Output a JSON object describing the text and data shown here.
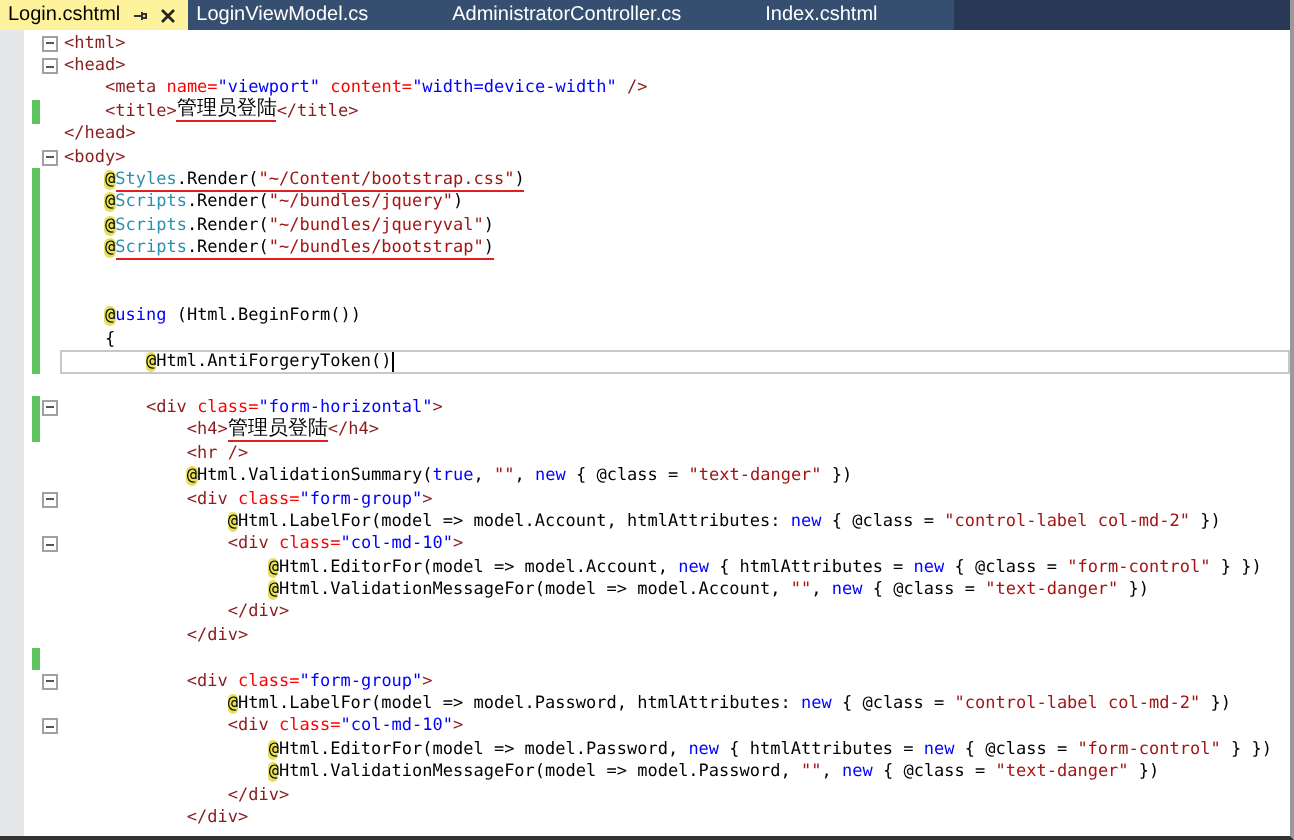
{
  "tabs": [
    {
      "label": "Login.cshtml",
      "selected": true,
      "pinned": true
    },
    {
      "label": "LoginViewModel.cs",
      "selected": false,
      "pinned": false
    },
    {
      "label": "AdministratorController.cs",
      "selected": false,
      "pinned": false
    },
    {
      "label": "Index.cshtml",
      "selected": false,
      "pinned": false
    }
  ],
  "lines": [
    {
      "changed": false,
      "foldable": true,
      "current": false,
      "tokens": [
        {
          "kind": "tag",
          "text": "<html>"
        }
      ]
    },
    {
      "changed": false,
      "foldable": true,
      "current": false,
      "tokens": [
        {
          "kind": "tag",
          "text": "<head>"
        }
      ]
    },
    {
      "changed": false,
      "foldable": false,
      "current": false,
      "tokens": [
        {
          "kind": "tag",
          "text": "    <meta"
        },
        {
          "kind": "attr",
          "text": " name="
        },
        {
          "kind": "value",
          "text": "\"viewport\""
        },
        {
          "kind": "attr",
          "text": " content="
        },
        {
          "kind": "value",
          "text": "\"width=device-width\""
        },
        {
          "kind": "tag",
          "text": " />"
        }
      ]
    },
    {
      "changed": true,
      "foldable": false,
      "current": false,
      "tokens": [
        {
          "kind": "tag",
          "text": "    <title>"
        },
        {
          "kind": "plain",
          "text": "管理员登陆",
          "underlined": true
        },
        {
          "kind": "tag",
          "text": "</title>"
        }
      ]
    },
    {
      "changed": false,
      "foldable": false,
      "current": false,
      "tokens": [
        {
          "kind": "tag",
          "text": "</head>"
        }
      ]
    },
    {
      "changed": false,
      "foldable": true,
      "current": false,
      "tokens": [
        {
          "kind": "tag",
          "text": "<body>"
        }
      ]
    },
    {
      "changed": true,
      "foldable": false,
      "current": false,
      "tokens": [
        {
          "kind": "razor",
          "text": "    @"
        },
        {
          "kind": "type",
          "text": "Styles",
          "underlined": true
        },
        {
          "kind": "plain",
          "text": ".Render(",
          "underlined": true
        },
        {
          "kind": "string",
          "text": "\"~/Content/bootstrap.css\"",
          "underlined": true
        },
        {
          "kind": "plain",
          "text": ")",
          "underlined": true
        }
      ]
    },
    {
      "changed": true,
      "foldable": false,
      "current": false,
      "tokens": [
        {
          "kind": "razor",
          "text": "    @"
        },
        {
          "kind": "type",
          "text": "Scripts"
        },
        {
          "kind": "plain",
          "text": ".Render("
        },
        {
          "kind": "string",
          "text": "\"~/bundles/jquery\""
        },
        {
          "kind": "plain",
          "text": ")"
        }
      ]
    },
    {
      "changed": true,
      "foldable": false,
      "current": false,
      "tokens": [
        {
          "kind": "razor",
          "text": "    @"
        },
        {
          "kind": "type",
          "text": "Scripts"
        },
        {
          "kind": "plain",
          "text": ".Render("
        },
        {
          "kind": "string",
          "text": "\"~/bundles/jqueryval\""
        },
        {
          "kind": "plain",
          "text": ")"
        }
      ]
    },
    {
      "changed": true,
      "foldable": false,
      "current": false,
      "tokens": [
        {
          "kind": "razor",
          "text": "    @"
        },
        {
          "kind": "type",
          "text": "Scripts",
          "underlined": true
        },
        {
          "kind": "plain",
          "text": ".Render(",
          "underlined": true
        },
        {
          "kind": "string",
          "text": "\"~/bundles/bootstrap\"",
          "underlined": true
        },
        {
          "kind": "plain",
          "text": ")",
          "underlined": true
        }
      ]
    },
    {
      "changed": true,
      "foldable": false,
      "current": false
    },
    {
      "changed": true,
      "foldable": false,
      "current": false
    },
    {
      "changed": true,
      "foldable": false,
      "current": false,
      "tokens": [
        {
          "kind": "razor",
          "text": "    @"
        },
        {
          "kind": "keyword",
          "text": "using"
        },
        {
          "kind": "plain",
          "text": " (Html.BeginForm())"
        }
      ]
    },
    {
      "changed": true,
      "foldable": false,
      "current": false,
      "tokens": [
        {
          "kind": "plain",
          "text": "    {"
        }
      ]
    },
    {
      "changed": true,
      "foldable": false,
      "current": true,
      "tokens": [
        {
          "kind": "razor",
          "text": "        @"
        },
        {
          "kind": "plain",
          "text": "Html.AntiForgeryToken()"
        }
      ]
    },
    {
      "changed": false,
      "foldable": false,
      "current": false
    },
    {
      "changed": true,
      "foldable": true,
      "current": false,
      "tokens": [
        {
          "kind": "tag",
          "text": "        <div"
        },
        {
          "kind": "attr",
          "text": " class="
        },
        {
          "kind": "value",
          "text": "\"form-horizontal\""
        },
        {
          "kind": "tag",
          "text": ">"
        }
      ]
    },
    {
      "changed": true,
      "foldable": false,
      "current": false,
      "tokens": [
        {
          "kind": "tag",
          "text": "            <h4>"
        },
        {
          "kind": "plain",
          "text": "管理员登陆",
          "underlined": true
        },
        {
          "kind": "tag",
          "text": "</h4>"
        }
      ]
    },
    {
      "changed": false,
      "foldable": false,
      "current": false,
      "tokens": [
        {
          "kind": "tag",
          "text": "            <hr />"
        }
      ]
    },
    {
      "changed": false,
      "foldable": false,
      "current": false,
      "tokens": [
        {
          "kind": "razor",
          "text": "            @"
        },
        {
          "kind": "plain",
          "text": "Html.ValidationSummary("
        },
        {
          "kind": "keyword",
          "text": "true"
        },
        {
          "kind": "plain",
          "text": ", "
        },
        {
          "kind": "string",
          "text": "\"\""
        },
        {
          "kind": "plain",
          "text": ", "
        },
        {
          "kind": "keyword",
          "text": "new"
        },
        {
          "kind": "plain",
          "text": " { @class = "
        },
        {
          "kind": "string",
          "text": "\"text-danger\""
        },
        {
          "kind": "plain",
          "text": " })"
        }
      ]
    },
    {
      "changed": false,
      "foldable": true,
      "current": false,
      "tokens": [
        {
          "kind": "tag",
          "text": "            <div"
        },
        {
          "kind": "attr",
          "text": " class="
        },
        {
          "kind": "value",
          "text": "\"form-group\""
        },
        {
          "kind": "tag",
          "text": ">"
        }
      ]
    },
    {
      "changed": false,
      "foldable": false,
      "current": false,
      "tokens": [
        {
          "kind": "razor",
          "text": "                @"
        },
        {
          "kind": "plain",
          "text": "Html.LabelFor(model => model.Account, htmlAttributes: "
        },
        {
          "kind": "keyword",
          "text": "new"
        },
        {
          "kind": "plain",
          "text": " { @class = "
        },
        {
          "kind": "string",
          "text": "\"control-label col-md-2\""
        },
        {
          "kind": "plain",
          "text": " })"
        }
      ]
    },
    {
      "changed": false,
      "foldable": true,
      "current": false,
      "tokens": [
        {
          "kind": "tag",
          "text": "                <div"
        },
        {
          "kind": "attr",
          "text": " class="
        },
        {
          "kind": "value",
          "text": "\"col-md-10\""
        },
        {
          "kind": "tag",
          "text": ">"
        }
      ]
    },
    {
      "changed": false,
      "foldable": false,
      "current": false,
      "tokens": [
        {
          "kind": "razor",
          "text": "                    @"
        },
        {
          "kind": "plain",
          "text": "Html.EditorFor(model => model.Account, "
        },
        {
          "kind": "keyword",
          "text": "new"
        },
        {
          "kind": "plain",
          "text": " { htmlAttributes = "
        },
        {
          "kind": "keyword",
          "text": "new"
        },
        {
          "kind": "plain",
          "text": " { @class = "
        },
        {
          "kind": "string",
          "text": "\"form-control\""
        },
        {
          "kind": "plain",
          "text": " } })"
        }
      ]
    },
    {
      "changed": false,
      "foldable": false,
      "current": false,
      "tokens": [
        {
          "kind": "razor",
          "text": "                    @"
        },
        {
          "kind": "plain",
          "text": "Html.ValidationMessageFor(model => model.Account, "
        },
        {
          "kind": "string",
          "text": "\"\""
        },
        {
          "kind": "plain",
          "text": ", "
        },
        {
          "kind": "keyword",
          "text": "new"
        },
        {
          "kind": "plain",
          "text": " { @class = "
        },
        {
          "kind": "string",
          "text": "\"text-danger\""
        },
        {
          "kind": "plain",
          "text": " })"
        }
      ]
    },
    {
      "changed": false,
      "foldable": false,
      "current": false,
      "tokens": [
        {
          "kind": "tag",
          "text": "                </div>"
        }
      ]
    },
    {
      "changed": false,
      "foldable": false,
      "current": false,
      "tokens": [
        {
          "kind": "tag",
          "text": "            </div>"
        }
      ]
    },
    {
      "changed": true,
      "foldable": false,
      "current": false
    },
    {
      "changed": false,
      "foldable": true,
      "current": false,
      "tokens": [
        {
          "kind": "tag",
          "text": "            <div"
        },
        {
          "kind": "attr",
          "text": " class="
        },
        {
          "kind": "value",
          "text": "\"form-group\""
        },
        {
          "kind": "tag",
          "text": ">"
        }
      ]
    },
    {
      "changed": false,
      "foldable": false,
      "current": false,
      "tokens": [
        {
          "kind": "razor",
          "text": "                @"
        },
        {
          "kind": "plain",
          "text": "Html.LabelFor(model => model.Password, htmlAttributes: "
        },
        {
          "kind": "keyword",
          "text": "new"
        },
        {
          "kind": "plain",
          "text": " { @class = "
        },
        {
          "kind": "string",
          "text": "\"control-label col-md-2\""
        },
        {
          "kind": "plain",
          "text": " })"
        }
      ]
    },
    {
      "changed": false,
      "foldable": true,
      "current": false,
      "tokens": [
        {
          "kind": "tag",
          "text": "                <div"
        },
        {
          "kind": "attr",
          "text": " class="
        },
        {
          "kind": "value",
          "text": "\"col-md-10\""
        },
        {
          "kind": "tag",
          "text": ">"
        }
      ]
    },
    {
      "changed": false,
      "foldable": false,
      "current": false,
      "tokens": [
        {
          "kind": "razor",
          "text": "                    @"
        },
        {
          "kind": "plain",
          "text": "Html.EditorFor(model => model.Password, "
        },
        {
          "kind": "keyword",
          "text": "new"
        },
        {
          "kind": "plain",
          "text": " { htmlAttributes = "
        },
        {
          "kind": "keyword",
          "text": "new"
        },
        {
          "kind": "plain",
          "text": " { @class = "
        },
        {
          "kind": "string",
          "text": "\"form-control\""
        },
        {
          "kind": "plain",
          "text": " } })"
        }
      ]
    },
    {
      "changed": false,
      "foldable": false,
      "current": false,
      "tokens": [
        {
          "kind": "razor",
          "text": "                    @"
        },
        {
          "kind": "plain",
          "text": "Html.ValidationMessageFor(model => model.Password, "
        },
        {
          "kind": "string",
          "text": "\"\""
        },
        {
          "kind": "plain",
          "text": ", "
        },
        {
          "kind": "keyword",
          "text": "new"
        },
        {
          "kind": "plain",
          "text": " { @class = "
        },
        {
          "kind": "string",
          "text": "\"text-danger\""
        },
        {
          "kind": "plain",
          "text": " })"
        }
      ]
    },
    {
      "changed": false,
      "foldable": false,
      "current": false,
      "tokens": [
        {
          "kind": "tag",
          "text": "                </div>"
        }
      ]
    },
    {
      "changed": false,
      "foldable": false,
      "current": false,
      "tokens": [
        {
          "kind": "tag",
          "text": "            </div>"
        }
      ]
    }
  ]
}
